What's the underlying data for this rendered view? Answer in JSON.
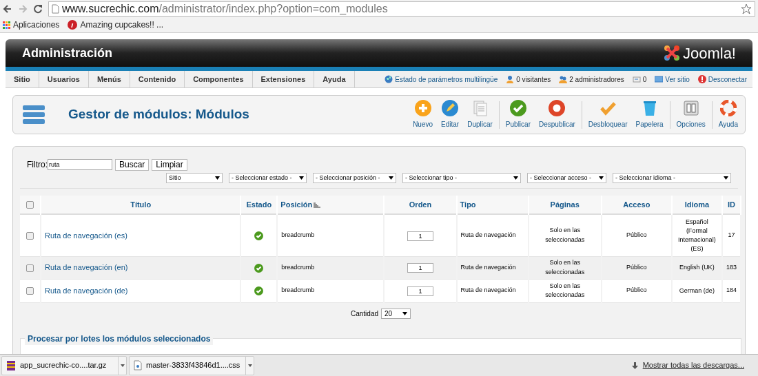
{
  "browser": {
    "url_host": "www.sucrechic.com",
    "url_path": "/administrator/index.php?option=com_modules",
    "bookmarks": [
      {
        "kind": "apps",
        "label": "Aplicaciones"
      },
      {
        "kind": "pin",
        "label": "Amazing cupcakes!! ..."
      }
    ]
  },
  "header": {
    "title": "Administración",
    "logo": "Joomla!"
  },
  "menu": [
    "Sitio",
    "Usuarios",
    "Menús",
    "Contenido",
    "Componentes",
    "Extensiones",
    "Ayuda"
  ],
  "status": [
    {
      "kind": "globe",
      "label": "Estado de parámetros multilingüe",
      "link": true
    },
    {
      "kind": "user",
      "label": "0 visitantes",
      "link": false
    },
    {
      "kind": "users",
      "label": "2 administradores",
      "link": false
    },
    {
      "kind": "mail",
      "label": "0",
      "link": false
    },
    {
      "kind": "screen",
      "label": "Ver sitio",
      "link": true
    },
    {
      "kind": "logout",
      "label": "Desconectar",
      "link": true
    }
  ],
  "toolbar": {
    "title": "Gestor de módulos: Módulos",
    "groups": [
      [
        {
          "kind": "new",
          "label": "Nuevo"
        },
        {
          "kind": "edit",
          "label": "Editar"
        },
        {
          "kind": "copy",
          "label": "Duplicar"
        }
      ],
      [
        {
          "kind": "publish",
          "label": "Publicar"
        },
        {
          "kind": "unpublish",
          "label": "Despublicar"
        }
      ],
      [
        {
          "kind": "checkin",
          "label": "Desbloquear"
        },
        {
          "kind": "trash",
          "label": "Papelera"
        }
      ],
      [
        {
          "kind": "options",
          "label": "Opciones"
        }
      ],
      [
        {
          "kind": "help",
          "label": "Ayuda"
        }
      ]
    ]
  },
  "filter": {
    "label": "Filtro:",
    "value": "ruta",
    "buttons": [
      "Buscar",
      "Limpiar"
    ],
    "selects": [
      "Sitio",
      "- Seleccionar estado -",
      "- Seleccionar posición -",
      "- Seleccionar tipo -",
      "- Seleccionar acceso -",
      "- Seleccionar idioma -"
    ]
  },
  "table": {
    "select_all_checked": false,
    "columns": [
      "Título",
      "Estado",
      "Posición",
      "Orden",
      "Tipo",
      "Páginas",
      "Acceso",
      "Idioma",
      "ID"
    ],
    "rows": [
      {
        "checked": false,
        "title": "Ruta de navegación (es)",
        "published": true,
        "position": "breadcrumb",
        "order": "1",
        "type": "Ruta de navegación",
        "pages": "Solo en las seleccionadas",
        "access": "Público",
        "language": "Español (Formal Internacional) (ES)",
        "id": "17"
      },
      {
        "checked": false,
        "title": "Ruta de navegación (en)",
        "published": true,
        "position": "breadcrumb",
        "order": "1",
        "type": "Ruta de navegación",
        "pages": "Solo en las seleccionadas",
        "access": "Público",
        "language": "English (UK)",
        "id": "183"
      },
      {
        "checked": false,
        "title": "Ruta de navegación (de)",
        "published": true,
        "position": "breadcrumb",
        "order": "1",
        "type": "Ruta de navegación",
        "pages": "Solo en las seleccionadas",
        "access": "Público",
        "language": "German (de)",
        "id": "184"
      }
    ]
  },
  "pagination": {
    "label": "Cantidad",
    "value": "20"
  },
  "batch": {
    "legend": "Procesar por lotes los módulos seleccionados"
  },
  "downloads": {
    "items": [
      {
        "kind": "archive",
        "label": "app_sucrechic-co....tar.gz"
      },
      {
        "kind": "file",
        "label": "master-3833f43846d1....css"
      }
    ],
    "show_all": "Mostrar todas las descargas..."
  }
}
